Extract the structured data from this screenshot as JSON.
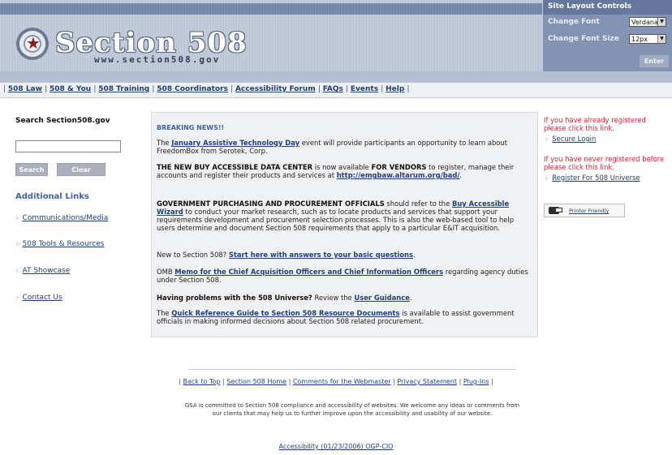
{
  "header": {
    "logo_title": "Section 508",
    "logo_url": "www.section508.gov"
  },
  "layout_controls": {
    "title": "Site Layout Controls",
    "font_label": "Change Font",
    "font_value": "Verdana",
    "size_label": "Change Font Size",
    "size_value": "12px",
    "enter_label": "Enter"
  },
  "nav": {
    "items": [
      "508 Law",
      "508 & You",
      "508 Training",
      "508 Coordinators",
      "Accessibility Forum",
      "FAQs",
      "Events",
      "Help"
    ]
  },
  "sidebar": {
    "search_title": "Search Section508.gov",
    "search_value": "",
    "search_button": "Search",
    "clear_button": "Clear",
    "additional_title": "Additional Links",
    "links": [
      "Communications/Media",
      "508 Tools & Resources",
      "AT Showcase",
      "Contact Us"
    ]
  },
  "main": {
    "breaking": "BREAKING NEWS!!",
    "p1": {
      "t1": "The ",
      "link": "January Assistive Technology Day",
      "t2": " event will provide participants an opportunity to learn about FreedomBox from Serotek, Corp."
    },
    "p2": {
      "b1": "THE NEW BUY ACCESSIBLE DATA CENTER",
      "t1": " is now available ",
      "b2": "FOR VENDORS",
      "t2": " to register, manage their accounts and register their products and services at ",
      "link": "http://emgbaw.altarum.org/bad/",
      "t3": "."
    },
    "p3": {
      "b1": "GOVERNMENT PURCHASING AND PROCUREMENT OFFICIALS",
      "t1": " should refer to the ",
      "link": "Buy Accessible Wizard",
      "t2": " to conduct your market research, such as to locate products and services that support your requirements development and procurement selection processes. This is also the web-based tool to help users determine and document Section 508 requirements that apply to a particular E&IT acquisition."
    },
    "p4": {
      "t1": "New to Section 508? ",
      "link": "Start here with answers to your basic questions",
      "t2": "."
    },
    "p5": {
      "t1": "OMB ",
      "link": "Memo for the Chief Acquisition Officers and Chief Information Officers",
      "t2": " regarding agency duties under Section 508."
    },
    "p6": {
      "b1": "Having problems with the 508 Universe?",
      "t1": " Review the ",
      "link": "User Guidance",
      "t2": "."
    },
    "p7": {
      "t1": "The ",
      "link": "Quick Reference Guide to Section 508 Resource Documents",
      "t2": " is available to assist government officials in making informed decisions about Section 508 related procurement."
    }
  },
  "right": {
    "note1": "If you have already registered please click this link.",
    "login_link": "Secure Login",
    "note2": "If you have never registered before please click this link.",
    "register_link": "Register For 508 Universe",
    "printer_label": "Printer Friendly"
  },
  "footer": {
    "links": [
      "Back to Top",
      "Section 508 Home",
      "Comments for the Webmaster",
      "Privacy Statement",
      "Plug-Ins"
    ],
    "text": "GSA is committed to Section 508 compliance and accessibility of websites. We welcome any ideas or comments from our clients that may help us to further improve upon the accessibility and usability of our website.",
    "accessibility": "Accessibility (01/23/2006) OGP-CIO"
  }
}
